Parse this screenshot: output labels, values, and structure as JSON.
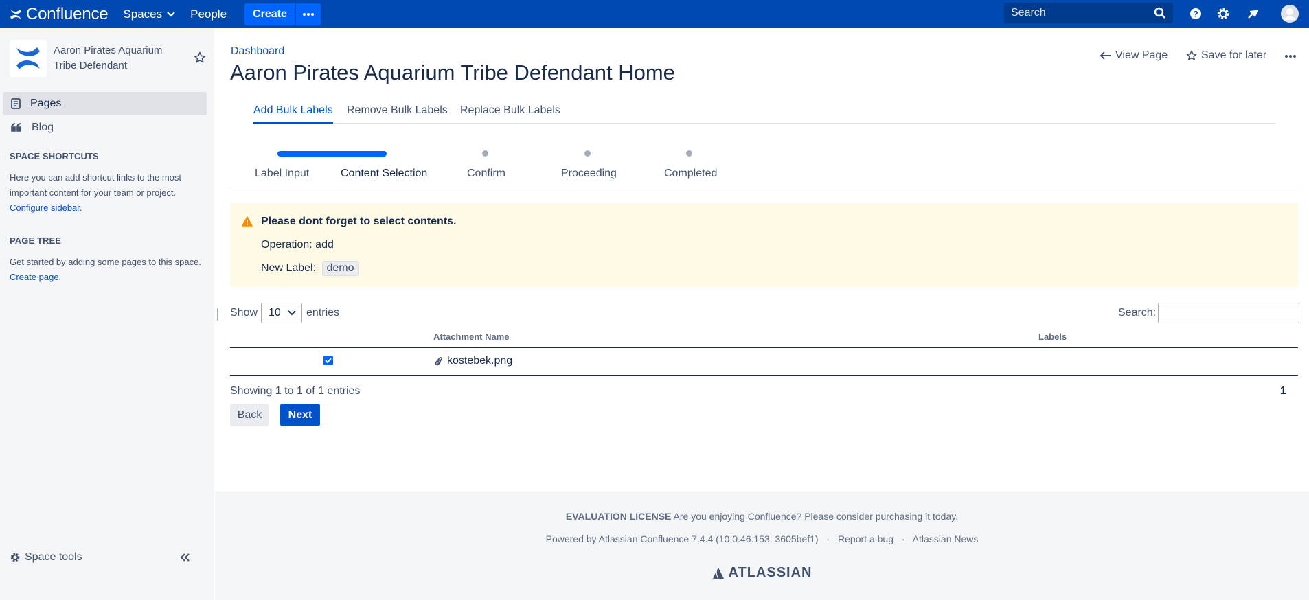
{
  "header": {
    "app_name": "Confluence",
    "nav": {
      "spaces": "Spaces",
      "people": "People"
    },
    "create_label": "Create",
    "search_placeholder": "Search",
    "brand_color": "#0049b0",
    "icons": [
      "confluence-logo-icon",
      "chevron-down-icon",
      "more-icon",
      "search-icon",
      "help-icon",
      "gear-icon",
      "notifications-icon",
      "avatar-icon"
    ]
  },
  "sidebar": {
    "space_name": "Aaron Pirates Aquarium Tribe Defendant",
    "items": [
      {
        "label": "Pages",
        "icon": "pages-icon",
        "active": true
      },
      {
        "label": "Blog",
        "icon": "quote-icon",
        "active": false
      }
    ],
    "shortcuts_heading": "SPACE SHORTCUTS",
    "shortcuts_text": "Here you can add shortcut links to the most important content for your team or project.",
    "configure_link": "Configure sidebar.",
    "tree_heading": "PAGE TREE",
    "tree_text": "Get started by adding some pages to this space.",
    "create_page_link": "Create page.",
    "space_tools": "Space tools"
  },
  "page": {
    "breadcrumb": "Dashboard",
    "title": "Aaron Pirates Aquarium Tribe Defendant Home",
    "actions": {
      "view_page": "View Page",
      "save_later": "Save for later"
    }
  },
  "tabs": [
    {
      "label": "Add Bulk Labels",
      "active": true
    },
    {
      "label": "Remove Bulk Labels",
      "active": false
    },
    {
      "label": "Replace Bulk Labels",
      "active": false
    }
  ],
  "steps": [
    "Label Input",
    "Content Selection",
    "Confirm",
    "Proceeding",
    "Completed"
  ],
  "warning": {
    "title": "Please dont forget to select contents.",
    "operation_label": "Operation:",
    "operation_value": "add",
    "new_label_label": "New Label:",
    "new_label_value": "demo"
  },
  "table": {
    "show_label": "Show",
    "entries_value": "10",
    "entries_label": "entries",
    "search_label": "Search:",
    "columns": [
      "Attachment Name",
      "Labels"
    ],
    "rows": [
      {
        "checked": true,
        "name": "kostebek.png",
        "labels": ""
      }
    ],
    "info": "Showing 1 to 1 of 1 entries",
    "page": "1"
  },
  "buttons": {
    "back": "Back",
    "next": "Next"
  },
  "footer": {
    "license_bold": "EVALUATION LICENSE",
    "license_text": "Are you enjoying Confluence? Please consider purchasing it today.",
    "powered": "Powered by Atlassian Confluence 7.4.4 (10.0.46.153: 3605bef1)",
    "report_bug": "Report a bug",
    "news": "Atlassian News",
    "brand": "ATLASSIAN",
    "separator": "·"
  }
}
